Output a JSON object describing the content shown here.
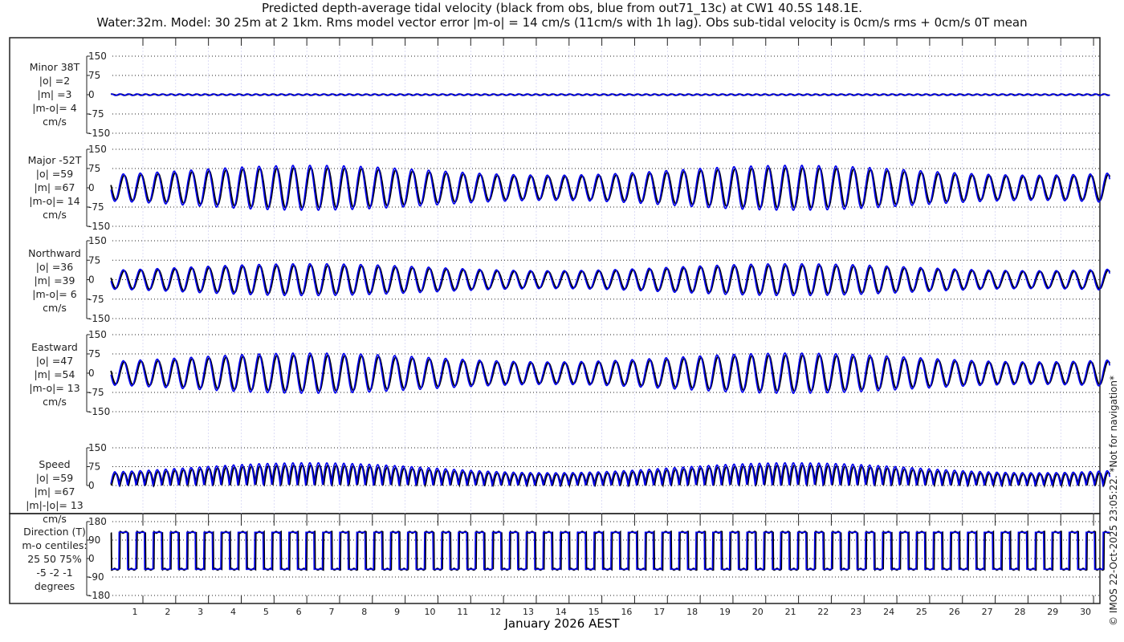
{
  "title_line1": "Predicted depth-average tidal velocity (black from obs, blue from out71_13c) at CW1 40.5S 148.1E.",
  "title_line2": "Water:32m. Model: 30 25m at 2 1km. Rms model vector error |m-o| = 14 cm/s (11cm/s with 1h lag). Obs sub-tidal velocity is 0cm/s rms + 0cm/s 0T mean",
  "copyright": "© IMOS 22-Oct-2025 23:05:22. *Not for navigation*",
  "colors": {
    "obs": "#000000",
    "model": "#0000ee",
    "grid": "#c8c8f0"
  },
  "chart_data": {
    "type": "line",
    "xlabel": "January 2026 AEST",
    "x_ticks": [
      "1",
      "2",
      "3",
      "4",
      "5",
      "6",
      "7",
      "8",
      "9",
      "10",
      "11",
      "12",
      "13",
      "14",
      "15",
      "16",
      "17",
      "18",
      "19",
      "20",
      "21",
      "22",
      "23",
      "24",
      "25",
      "26",
      "27",
      "28",
      "29",
      "30"
    ],
    "tidal_period_hours": 12.42,
    "panels": [
      {
        "name": "minor",
        "label": [
          "Minor 38T",
          "|o| =2",
          "|m| =3",
          "|m-o|= 4",
          "cm/s"
        ],
        "ylim": [
          -150,
          150
        ],
        "yticks": [
          "150",
          "75",
          "0",
          "-75",
          "-150"
        ],
        "amplitude": 3
      },
      {
        "name": "major",
        "label": [
          "Major -52T",
          "|o| =59",
          "|m| =67",
          "|m-o|= 14",
          "cm/s"
        ],
        "ylim": [
          -150,
          150
        ],
        "yticks": [
          "150",
          "75",
          "0",
          "-75",
          "-150"
        ],
        "amplitude": 85
      },
      {
        "name": "northward",
        "label": [
          "Northward",
          "|o| =36",
          "|m| =39",
          "|m-o|= 6",
          "cm/s"
        ],
        "ylim": [
          -150,
          150
        ],
        "yticks": [
          "150",
          "75",
          "0",
          "-75",
          "-150"
        ],
        "amplitude": 55
      },
      {
        "name": "eastward",
        "label": [
          "Eastward",
          "|o| =47",
          "|m| =54",
          "|m-o|= 13",
          "cm/s"
        ],
        "ylim": [
          -150,
          150
        ],
        "yticks": [
          "150",
          "75",
          "0",
          "-75",
          "-150"
        ],
        "amplitude": 70
      },
      {
        "name": "speed",
        "label": [
          "Speed",
          "|o| =59",
          "|m| =67",
          "|m|-|o|= 13",
          "cm/s"
        ],
        "ylim": [
          0,
          150
        ],
        "yticks": [
          "150",
          "75",
          "0"
        ],
        "amplitude": 85
      },
      {
        "name": "direction",
        "label": [
          "Direction (T)",
          "m-o centiles:",
          "25  50  75%",
          "-5 -2 -1",
          "degrees"
        ],
        "ylim": [
          -180,
          180
        ],
        "yticks": [
          "180",
          "90",
          "0",
          "-90",
          "-180"
        ],
        "levels": [
          128,
          -52
        ]
      }
    ]
  }
}
